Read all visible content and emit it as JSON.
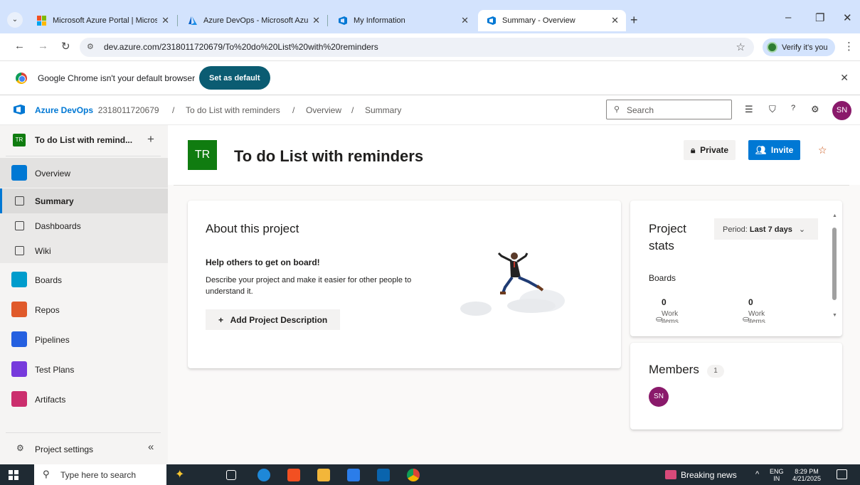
{
  "browser": {
    "tabs": [
      {
        "title": "Microsoft Azure Portal | Micros",
        "active": false
      },
      {
        "title": "Azure DevOps - Microsoft Azur",
        "active": false
      },
      {
        "title": "My Information",
        "active": false
      },
      {
        "title": "Summary - Overview",
        "active": true
      }
    ],
    "url": "dev.azure.com/2318011720679/To%20do%20List%20with%20reminders",
    "verify_label": "Verify it's you",
    "infobar_text": "Google Chrome isn't your default browser",
    "set_default_label": "Set as default"
  },
  "header": {
    "brand": "Azure DevOps",
    "org": "2318011720679",
    "breadcrumb": [
      "To do List with reminders",
      "Overview",
      "Summary"
    ],
    "search_placeholder": "Search",
    "user_initials": "SN"
  },
  "sidebar": {
    "project_initials": "TR",
    "project_name": "To do List with remind...",
    "items": [
      {
        "label": "Overview",
        "icon": "overview-icon",
        "color": "#0078d4"
      },
      {
        "label": "Summary",
        "icon": "summary-icon"
      },
      {
        "label": "Dashboards",
        "icon": "dashboards-icon"
      },
      {
        "label": "Wiki",
        "icon": "wiki-icon"
      },
      {
        "label": "Boards",
        "icon": "boards-icon",
        "color": "#009ccc"
      },
      {
        "label": "Repos",
        "icon": "repos-icon",
        "color": "#e05a2b"
      },
      {
        "label": "Pipelines",
        "icon": "pipelines-icon",
        "color": "#2560e0"
      },
      {
        "label": "Test Plans",
        "icon": "test-plans-icon",
        "color": "#773adc"
      },
      {
        "label": "Artifacts",
        "icon": "artifacts-icon",
        "color": "#cb2e6d"
      }
    ],
    "settings_label": "Project settings"
  },
  "project": {
    "initials": "TR",
    "title": "To do List with reminders",
    "private_label": "Private",
    "invite_label": "Invite"
  },
  "about": {
    "heading": "About this project",
    "subheading": "Help others to get on board!",
    "description": "Describe your project and make it easier for other people to understand it.",
    "add_button": "Add Project Description"
  },
  "stats": {
    "heading": "Project stats",
    "period_label": "Period:",
    "period_value": "Last 7 days",
    "section": "Boards",
    "items": [
      {
        "value": "0",
        "label": "Work items"
      },
      {
        "value": "0",
        "label": "Work items"
      }
    ]
  },
  "members": {
    "heading": "Members",
    "count": "1",
    "avatars": [
      "SN"
    ]
  },
  "taskbar": {
    "search_placeholder": "Type here to search",
    "news": "Breaking news",
    "lang_top": "ENG",
    "lang_bottom": "IN",
    "time": "8:29 PM",
    "date": "4/21/2025"
  },
  "colors": {
    "brand": "#0078d4",
    "project_green": "#107c10",
    "avatar": "#8a1a6b"
  }
}
